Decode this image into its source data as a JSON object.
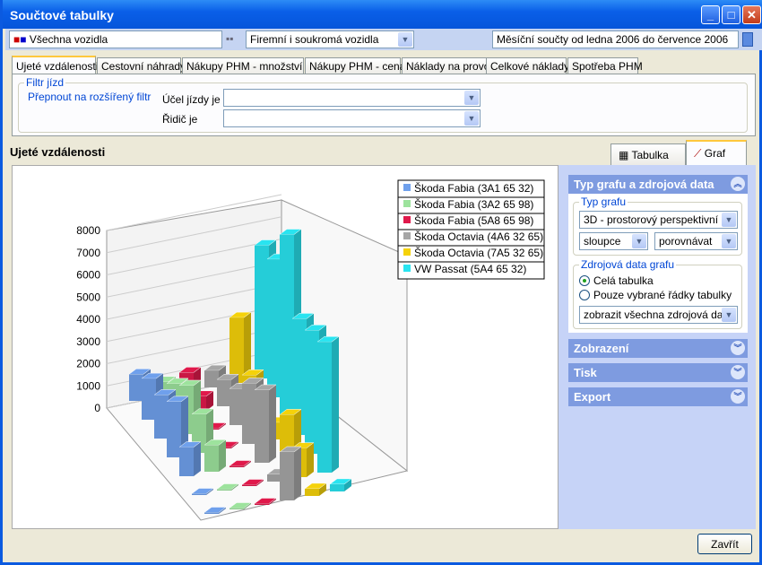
{
  "window": {
    "title": "Součtové tabulky"
  },
  "toolbar": {
    "vehicles": "Všechna vozidla",
    "vehicle_type": "Firemní i soukromá vozidla",
    "period": "Měsíční součty od ledna 2006 do července 2006"
  },
  "tabs": [
    "Ujeté vzdálenosti",
    "Cestovní náhrady",
    "Nákupy PHM - množství",
    "Nákupy PHM - cena",
    "Náklady na provoz",
    "Celkové náklady",
    "Spotřeba PHM"
  ],
  "filter": {
    "title": "Filtr jízd",
    "toggle_link": "Přepnout na rozšířený filtr",
    "purpose_label": "Účel jízdy je",
    "purpose_value": "",
    "driver_label": "Řidič je",
    "driver_value": ""
  },
  "section_title": "Ujeté vzdálenosti",
  "view_tabs": {
    "table": "Tabulka",
    "chart": "Graf",
    "active": "Graf"
  },
  "side": {
    "header": "Typ grafu a zdrojová data",
    "type_group": "Typ grafu",
    "chart_type": "3D - prostorový perspektivní",
    "shape": "sloupce",
    "mode": "porovnávat",
    "source_group": "Zdrojová data grafu",
    "radio_all": "Celá tabulka",
    "radio_selected": "Pouze vybrané řádky tabulky",
    "source_filter": "zobrazit všechna zdrojová data",
    "sections": [
      "Zobrazení",
      "Tisk",
      "Export"
    ]
  },
  "close_button": "Zavřít",
  "chart_data": {
    "type": "bar",
    "style": "3d",
    "ylim": [
      0,
      8000
    ],
    "yticks": [
      "0",
      "1000",
      "2000",
      "3000",
      "4000",
      "5000",
      "6000",
      "7000",
      "8000"
    ],
    "legend_position": "top-right",
    "series": [
      {
        "name": "Škoda Fabia (3A1 65 32)",
        "color": "#6fa0ec",
        "values": [
          1100,
          1700,
          1800,
          2300,
          1200,
          0,
          0
        ]
      },
      {
        "name": "Škoda Fabia (3A2 65 98)",
        "color": "#9de39d",
        "values": [
          600,
          1300,
          2000,
          1600,
          1100,
          0,
          0
        ]
      },
      {
        "name": "Škoda Fabia (5A8 65 98)",
        "color": "#e0194b",
        "values": [
          800,
          600,
          0,
          0,
          0,
          0,
          0
        ]
      },
      {
        "name": "Škoda Octavia (4A6 32 65)",
        "color": "#a6a6a6",
        "values": [
          700,
          1100,
          1500,
          2500,
          3000,
          300,
          2000
        ]
      },
      {
        "name": "Škoda Octavia (7A5 32 65)",
        "color": "#f5d20a",
        "values": [
          2700,
          1100,
          900,
          700,
          1800,
          1200,
          300
        ]
      },
      {
        "name": "VW Passat (5A4 65 32)",
        "color": "#29e4f0",
        "values": [
          5500,
          5700,
          7500,
          4800,
          5100,
          5400,
          300
        ]
      }
    ]
  }
}
